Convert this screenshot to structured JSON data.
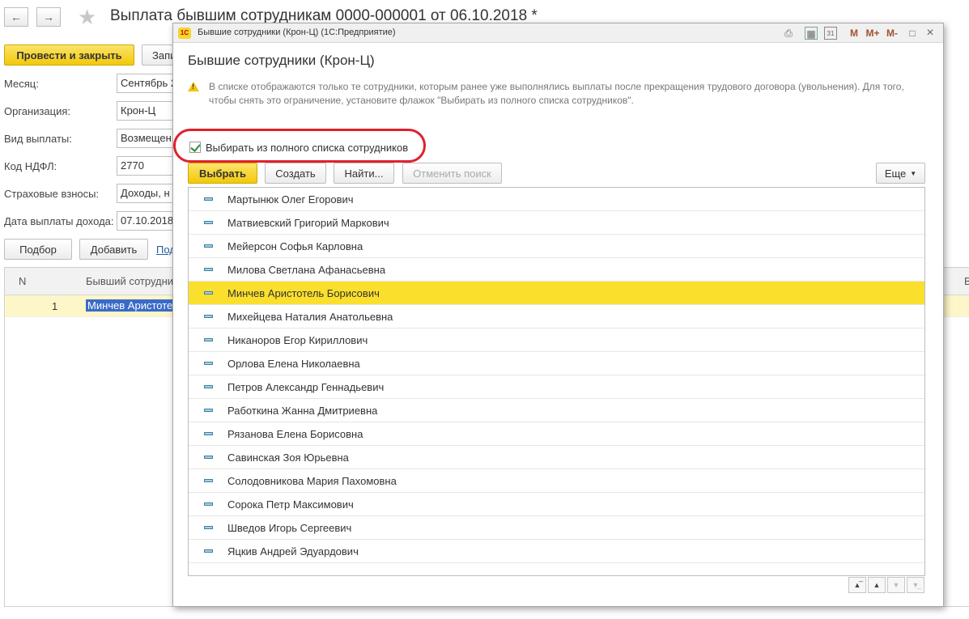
{
  "document": {
    "title": "Выплата бывшим сотрудникам 0000-000001 от 06.10.2018 *",
    "post_close_label": "Провести и закрыть",
    "write_label": "Запи",
    "fields": [
      {
        "label": "Месяц:",
        "value": "Сентябрь 2"
      },
      {
        "label": "Организация:",
        "value": "Крон-Ц"
      },
      {
        "label": "Вид выплаты:",
        "value": "Возмещен"
      },
      {
        "label": "Код НДФЛ:",
        "value": "2770"
      },
      {
        "label": "Страховые взносы:",
        "value": "Доходы, н"
      },
      {
        "label": "Дата выплаты дохода:",
        "value": "07.10.2018"
      }
    ],
    "pick_label": "Подбор",
    "add_label": "Добавить",
    "link_label": "Под",
    "grid": {
      "col_n": "N",
      "col_employee": "Бывший сотрудник",
      "col_extra": "В",
      "rows": [
        {
          "n": "1",
          "employee": "Минчев Аристотел"
        }
      ]
    }
  },
  "modal": {
    "window_title": "Бывшие сотрудники (Крон-Ц)  (1С:Предприятие)",
    "logo_text": "1С",
    "toolbar": {
      "m": "M",
      "m_plus": "M+",
      "m_minus": "M-",
      "calendar_day": "31"
    },
    "form_title": "Бывшие сотрудники (Крон-Ц)",
    "warning_text": "В списке отображаются только те сотрудники, которым ранее уже выполнялись выплаты после прекращения трудового договора (увольнения). Для того, чтобы снять это ограничение, установите флажок \"Выбирать из полного списка сотрудников\".",
    "checkbox_label": "Выбирать из полного списка сотрудников",
    "checkbox_checked": true,
    "buttons": {
      "select": "Выбрать",
      "create": "Создать",
      "find": "Найти...",
      "cancel_search": "Отменить поиск",
      "more": "Еще"
    },
    "employees": [
      "Мартынюк Олег Егорович",
      "Матвиевский Григорий Маркович",
      "Мейерсон Софья Карловна",
      "Милова Светлана Афанасьевна",
      "Минчев Аристотель Борисович",
      "Михейцева Наталия Анатольевна",
      "Никаноров Егор Кириллович",
      "Орлова Елена Николаевна",
      "Петров Александр Геннадьевич",
      "Работкина Жанна Дмитриевна",
      "Рязанова Елена Борисовна",
      "Савинская Зоя Юрьевна",
      "Солодовникова Мария Пахомовна",
      "Сорока Петр Максимович",
      "Шведов Игорь Сергеевич",
      "Яцкив Андрей Эдуардович"
    ],
    "selected_employee": "Минчев Аристотель Борисович"
  },
  "colors": {
    "accent_yellow": "#fbdf2d",
    "highlight_red": "#e0202e",
    "selection_blue": "#3a6bc8"
  }
}
